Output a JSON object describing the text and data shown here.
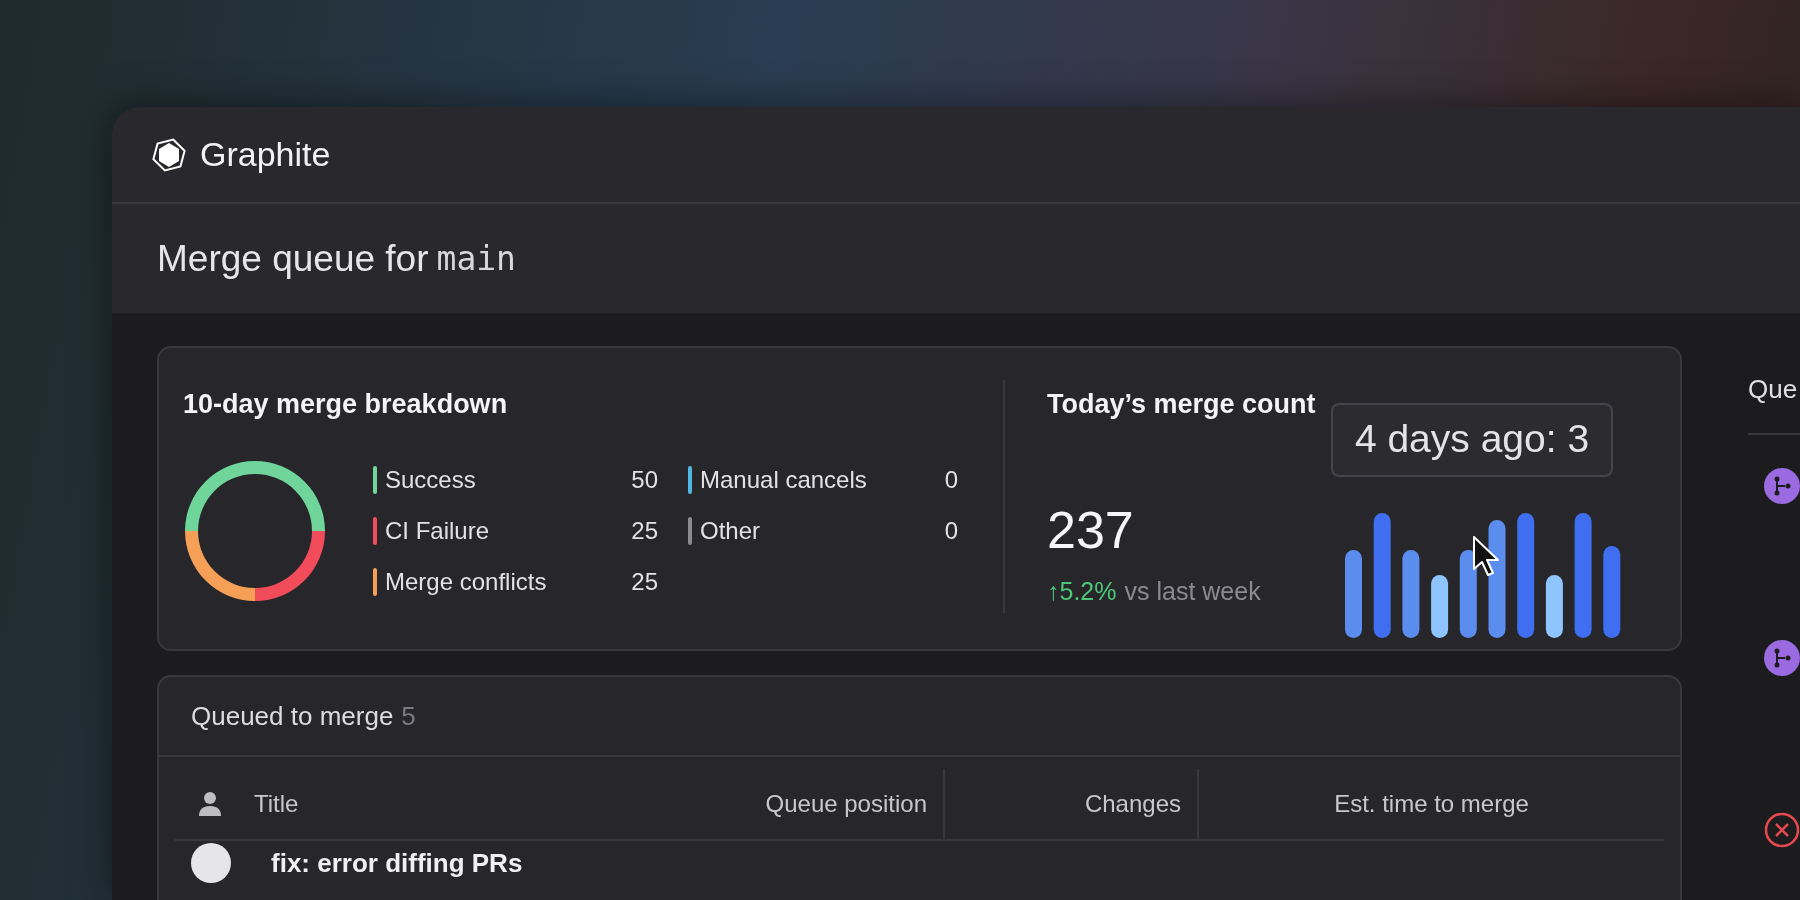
{
  "app": {
    "name": "Graphite"
  },
  "page_header": {
    "title": "Merge queue for",
    "branch": "main"
  },
  "breakdown": {
    "title": "10-day merge breakdown",
    "chart_data": {
      "type": "donut",
      "categories": [
        "Success",
        "CI Failure",
        "Merge conflicts",
        "Manual cancels",
        "Other"
      ],
      "values": [
        50,
        25,
        25,
        0,
        0
      ]
    },
    "legend": [
      {
        "count": "50",
        "color": "#6fd59b"
      },
      {
        "count": "25",
        "color": "#f24b5a"
      },
      {
        "count": "25",
        "color": "#f5a056"
      },
      {
        "count": "0",
        "color": "#4fb8e0"
      },
      {
        "count": "0",
        "color": "#8a8a8f"
      }
    ]
  },
  "merge_count": {
    "title": "Today’s merge count",
    "value": "237",
    "change_arrow": "↑",
    "change": "5.2%",
    "comparison": "vs last week",
    "tooltip": "4 days ago: 3"
  },
  "queue": {
    "title": "Queued to merge",
    "count": "5",
    "columns": [
      "Title",
      "Queue position",
      "Changes",
      "Est. time to merge"
    ],
    "rows": [
      {
        "title": "fix: error diffing PRs"
      }
    ]
  },
  "side_panel": {
    "title": "Que",
    "items": [
      {
        "kind": "branch"
      },
      {
        "kind": "branch"
      },
      {
        "kind": "failed"
      }
    ]
  }
}
